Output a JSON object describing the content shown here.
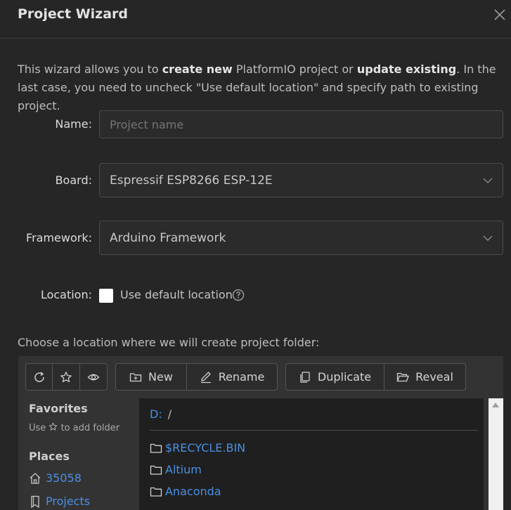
{
  "dialog": {
    "title": "Project Wizard"
  },
  "description": {
    "part1": "This wizard allows you to ",
    "bold1": "create new",
    "part2": " PlatformIO project or ",
    "bold2": "update existing",
    "part3": ". In the last case, you need to uncheck \"Use default location\" and specify path to existing project."
  },
  "form": {
    "name_label": "Name",
    "name_placeholder": "Project name",
    "board_label": "Board",
    "board_value": "Espressif ESP8266 ESP-12E",
    "framework_label": "Framework",
    "framework_value": "Arduino Framework",
    "location_label": "Location",
    "default_location_label": "Use default location",
    "default_location_checked": false
  },
  "choose_text": "Choose a location where we will create project folder:",
  "toolbar": {
    "refresh_icon": "refresh-icon",
    "star_icon": "star-icon",
    "eye_icon": "eye-icon",
    "new_label": "New",
    "rename_label": "Rename",
    "duplicate_label": "Duplicate",
    "reveal_label": "Reveal"
  },
  "sidebar": {
    "favorites_title": "Favorites",
    "favorites_hint_pre": "Use",
    "favorites_hint_post": "to add folder",
    "places_title": "Places",
    "places": [
      {
        "label": "35058",
        "icon": "home-icon"
      },
      {
        "label": "Projects",
        "icon": "bookmark-icon"
      }
    ]
  },
  "browser": {
    "drive": "D:",
    "separator": "/",
    "items": [
      "$RECYCLE.BIN",
      "Altium",
      "Anaconda"
    ]
  },
  "colors": {
    "accent": "#4a90e2",
    "background": "#262626"
  }
}
